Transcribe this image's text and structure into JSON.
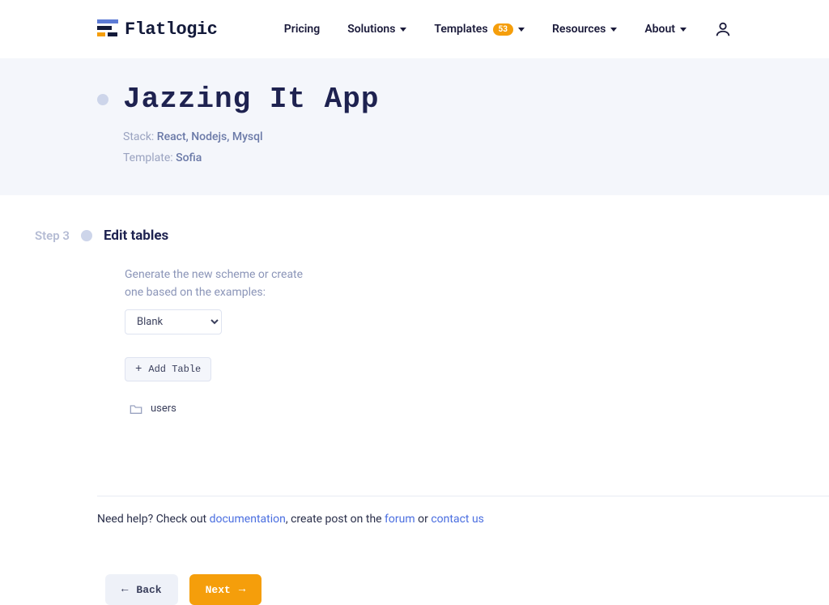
{
  "brand": "Flatlogic",
  "nav": {
    "pricing": "Pricing",
    "solutions": "Solutions",
    "templates": "Templates",
    "templates_badge": "53",
    "resources": "Resources",
    "about": "About"
  },
  "hero": {
    "title": "Jazzing It App",
    "stack_label": "Stack: ",
    "stack_value": "React, Nodejs, Mysql",
    "template_label": "Template: ",
    "template_value": "Sofia"
  },
  "step": {
    "label": "Step 3",
    "title": "Edit tables"
  },
  "scheme": {
    "instruction": "Generate the new scheme or create one based on the examples:",
    "selected": "Blank",
    "options": [
      "Blank"
    ],
    "add_table": "Add Table",
    "tables": [
      "users"
    ]
  },
  "help": {
    "prefix": "Need help? Check out ",
    "doc": "documentation",
    "mid1": ", create post on the ",
    "forum": "forum",
    "mid2": " or ",
    "contact": "contact us"
  },
  "buttons": {
    "back": "Back",
    "next": "Next"
  }
}
